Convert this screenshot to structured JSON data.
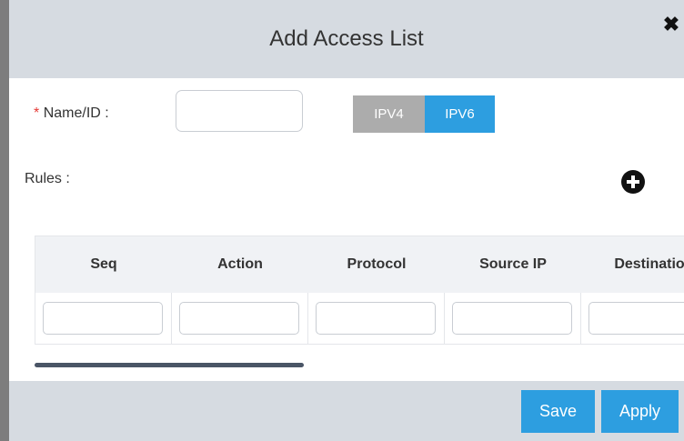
{
  "dialog": {
    "title": "Add Access List",
    "close_label": "✖"
  },
  "form": {
    "name_required_mark": "*",
    "name_label": "Name/ID :",
    "name_value": "",
    "ip_version": {
      "options": [
        "IPV4",
        "IPV6"
      ],
      "selected": "IPV6"
    },
    "rules_label": "Rules :"
  },
  "rules_table": {
    "columns": [
      "Seq",
      "Action",
      "Protocol",
      "Source IP",
      "Destinatio"
    ],
    "filters": [
      "",
      "",
      "",
      "",
      ""
    ]
  },
  "footer": {
    "save_label": "Save",
    "apply_label": "Apply"
  },
  "colors": {
    "header_bg": "#d6dbe1",
    "primary": "#2d9ee0",
    "inactive_toggle": "#acacac",
    "required": "#e53935"
  },
  "icons": {
    "close": "close-icon",
    "add_rule": "plus-circle-icon",
    "filter": "search-icon"
  }
}
